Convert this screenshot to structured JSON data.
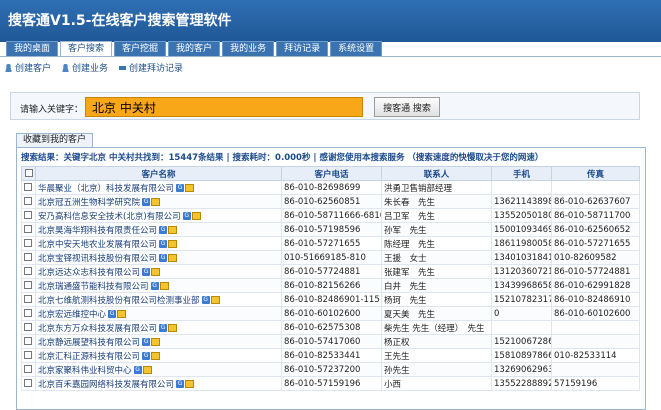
{
  "app": {
    "title": "搜客通V1.5-在线客户搜索管理软件"
  },
  "tabs": [
    {
      "label": "我的桌面",
      "active": false
    },
    {
      "label": "客户搜索",
      "active": true
    },
    {
      "label": "客户挖掘",
      "active": false
    },
    {
      "label": "我的客户",
      "active": false
    },
    {
      "label": "我的业务",
      "active": false
    },
    {
      "label": "拜访记录",
      "active": false
    },
    {
      "label": "系统设置",
      "active": false
    }
  ],
  "subnav": [
    {
      "label": "创建客户",
      "icon": "user-icon"
    },
    {
      "label": "创建业务",
      "icon": "user-icon"
    },
    {
      "label": "创建拜访记录",
      "icon": "car-icon"
    }
  ],
  "search": {
    "label": "请输入关键字：",
    "value": "北京 中关村",
    "button_label": "搜客通 搜索"
  },
  "results": {
    "tab_label": "收藏到我的客户",
    "summary": "搜索结果：关键字北京 中关村共找到：15447条结果 | 搜索耗时：0.000秒 | 感谢您使用本搜索服务 （搜索速度的快慢取决于您的网速）",
    "columns": [
      "",
      "客户名称",
      "客户电话",
      "联系人",
      "手机",
      "传真"
    ],
    "rows": [
      {
        "name": "华晨聚业（北京）科技发展有限公司",
        "phone": "86-010-82698699",
        "contact": "洪勇卫售销部经理",
        "mobile": "",
        "fax": ""
      },
      {
        "name": "北京冠五洲生物科学研究院",
        "phone": "86-010-62560851",
        "contact": "朱长春　先生",
        "mobile": "13621143898",
        "fax": "86-010-62637607"
      },
      {
        "name": "安乃高科信息安全技术(北京)有限公司",
        "phone": "86-010-58711666-6816",
        "contact": "吕卫军　先生",
        "mobile": "13552050180",
        "fax": "86-010-58711700"
      },
      {
        "name": "北京昊海华翔科技有限责任公司",
        "phone": "86-010-57198596",
        "contact": "孙军　先生",
        "mobile": "15001093469",
        "fax": "86-010-62560652"
      },
      {
        "name": "北京中安天地农业发展有限公司",
        "phone": "86-010-57271655",
        "contact": "陈经理　先生",
        "mobile": "18611980058",
        "fax": "86-010-57271655"
      },
      {
        "name": "北京宝铎视讯科技股份有限公司",
        "phone": "010-51669185-810",
        "contact": "王援　女士",
        "mobile": "13401031841",
        "fax": "010-82609582"
      },
      {
        "name": "北京远达众志科技有限公司",
        "phone": "86-010-57724881",
        "contact": "张建军　先生",
        "mobile": "13120360721",
        "fax": "86-010-57724881"
      },
      {
        "name": "北京瑞通盛节能科技有限公司",
        "phone": "86-010-82156266",
        "contact": "白井　先生",
        "mobile": "13439968658",
        "fax": "86-010-62991828"
      },
      {
        "name": "北京七维航测科技股份有限公司检测事业部",
        "phone": "86-010-82486901-115",
        "contact": "杨珂　先生",
        "mobile": "15210782317",
        "fax": "86-010-82486910"
      },
      {
        "name": "北京宏远维控中心",
        "phone": "86-010-60102600",
        "contact": "夏天美　先生",
        "mobile": "0",
        "fax": "86-010-60102600"
      },
      {
        "name": "北京东方万众科技发展有限公司",
        "phone": "86-010-62575308",
        "contact": "柴先生 先生（经理）　先生",
        "mobile": "",
        "fax": ""
      },
      {
        "name": "北京静远展望科技有限公司",
        "phone": "86-010-57417060",
        "contact": "杨正权",
        "mobile": "15210067286",
        "fax": ""
      },
      {
        "name": "北京汇科正源科技有限公司",
        "phone": "86-010-82533441",
        "contact": "王先生",
        "mobile": "15810897866",
        "fax": "010-82533114"
      },
      {
        "name": "北京家聚科伟业科贸中心",
        "phone": "86-010-57237200",
        "contact": "孙先生",
        "mobile": "13269062963",
        "fax": ""
      },
      {
        "name": "北京百禾嘉园网络科技发展有限公司",
        "phone": "86-010-57159196",
        "contact": "小西",
        "mobile": "13552288892",
        "fax": "57159196"
      }
    ]
  },
  "colors": {
    "header_bg": "#2f6fb3",
    "search_input_bg": "#f7a718",
    "link_text": "#1c4a8b"
  }
}
